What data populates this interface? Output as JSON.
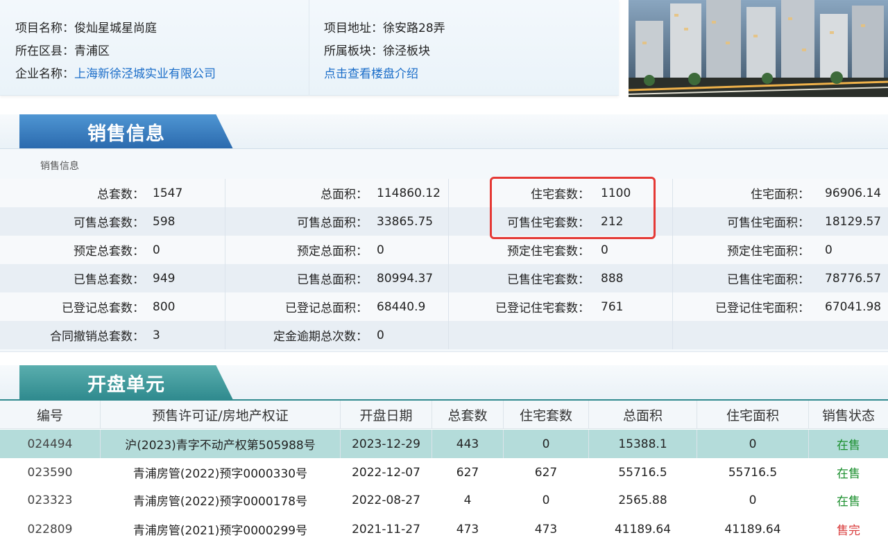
{
  "project": {
    "name_label": "项目名称：",
    "name_value": "俊灿星城星尚庭",
    "district_label": "所在区县：",
    "district_value": "青浦区",
    "company_label": "企业名称：",
    "company_value": "上海新徐泾城实业有限公司",
    "address_label": "项目地址：",
    "address_value": "徐安路28弄",
    "block_label": "所属板块：",
    "block_value": "徐泾板块",
    "intro_link": "点击查看楼盘介绍"
  },
  "sales": {
    "section_title": "销售信息",
    "caption": "销售信息",
    "rows": [
      [
        [
          "总套数：",
          "1547"
        ],
        [
          "总面积：",
          "114860.12"
        ],
        [
          "住宅套数：",
          "1100"
        ],
        [
          "住宅面积：",
          "96906.14"
        ]
      ],
      [
        [
          "可售总套数：",
          "598"
        ],
        [
          "可售总面积：",
          "33865.75"
        ],
        [
          "可售住宅套数：",
          "212"
        ],
        [
          "可售住宅面积：",
          "18129.57"
        ]
      ],
      [
        [
          "预定总套数：",
          "0"
        ],
        [
          "预定总面积：",
          "0"
        ],
        [
          "预定住宅套数：",
          "0"
        ],
        [
          "预定住宅面积：",
          "0"
        ]
      ],
      [
        [
          "已售总套数：",
          "949"
        ],
        [
          "已售总面积：",
          "80994.37"
        ],
        [
          "已售住宅套数：",
          "888"
        ],
        [
          "已售住宅面积：",
          "78776.57"
        ]
      ],
      [
        [
          "已登记总套数：",
          "800"
        ],
        [
          "已登记总面积：",
          "68440.9"
        ],
        [
          "已登记住宅套数：",
          "761"
        ],
        [
          "已登记住宅面积：",
          "67041.98"
        ]
      ],
      [
        [
          "合同撤销总套数：",
          "3"
        ],
        [
          "定金逾期总次数：",
          "0"
        ],
        [
          "",
          ""
        ],
        [
          "",
          ""
        ]
      ]
    ]
  },
  "units": {
    "section_title": "开盘单元",
    "headers": [
      "编号",
      "预售许可证/房地产权证",
      "开盘日期",
      "总套数",
      "住宅套数",
      "总面积",
      "住宅面积",
      "销售状态"
    ],
    "rows": [
      [
        "024494",
        "沪(2023)青字不动产权第505988号",
        "2023-12-29",
        "443",
        "0",
        "15388.1",
        "0",
        "在售"
      ],
      [
        "023590",
        "青浦房管(2022)预字0000330号",
        "2022-12-07",
        "627",
        "627",
        "55716.5",
        "55716.5",
        "在售"
      ],
      [
        "023323",
        "青浦房管(2022)预字0000178号",
        "2022-08-27",
        "4",
        "0",
        "2565.88",
        "0",
        "在售"
      ],
      [
        "022809",
        "青浦房管(2021)预字0000299号",
        "2021-11-27",
        "473",
        "473",
        "41189.64",
        "41189.64",
        "售完"
      ]
    ]
  },
  "colors": {
    "on_sale": "#1b8f2e",
    "sold_out": "#d93a3a",
    "highlight": "#e53935",
    "link": "#1a6dc9"
  }
}
